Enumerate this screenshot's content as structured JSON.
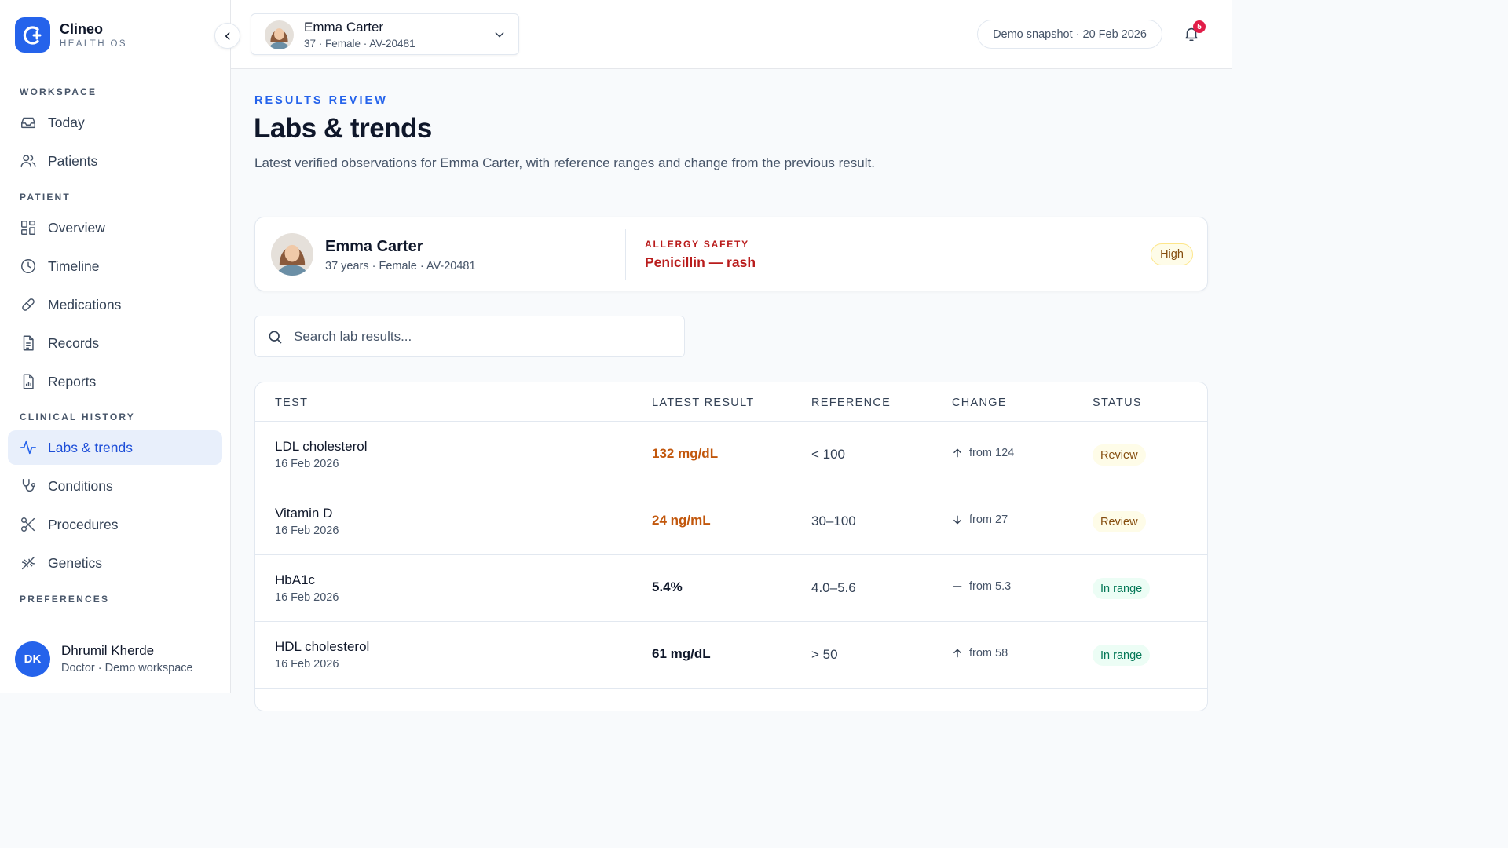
{
  "brand": {
    "name": "Clineo",
    "subtitle": "HEALTH OS"
  },
  "sidebar": {
    "sections": [
      "WORKSPACE",
      "PATIENT",
      "CLINICAL HISTORY",
      "PREFERENCES"
    ],
    "items": [
      {
        "label": "Today",
        "icon": "inbox-icon"
      },
      {
        "label": "Patients",
        "icon": "users-icon"
      },
      {
        "label": "Overview",
        "icon": "grid-icon"
      },
      {
        "label": "Timeline",
        "icon": "clock-icon"
      },
      {
        "label": "Medications",
        "icon": "pill-icon"
      },
      {
        "label": "Records",
        "icon": "file-icon"
      },
      {
        "label": "Reports",
        "icon": "report-icon"
      },
      {
        "label": "Labs & trends",
        "icon": "activity-icon",
        "active": true
      },
      {
        "label": "Conditions",
        "icon": "stethoscope-icon"
      },
      {
        "label": "Procedures",
        "icon": "scissors-icon"
      },
      {
        "label": "Genetics",
        "icon": "dna-icon"
      }
    ]
  },
  "user": {
    "initials": "DK",
    "name": "Dhrumil Kherde",
    "role": "Doctor · Demo workspace"
  },
  "topbar": {
    "patient_name": "Emma Carter",
    "patient_meta": "37 · Female · AV-20481",
    "snapshot": "Demo snapshot · 20 Feb 2026",
    "notifications": "5"
  },
  "page": {
    "eyebrow": "RESULTS REVIEW",
    "title": "Labs & trends",
    "description": "Latest verified observations for Emma Carter, with reference ranges and change from the previous result."
  },
  "patient_card": {
    "name": "Emma Carter",
    "meta": "37 years · Female · AV-20481",
    "allergy_label": "ALLERGY SAFETY",
    "allergy_value": "Penicillin — rash",
    "severity": "High"
  },
  "search": {
    "placeholder": "Search lab results..."
  },
  "table": {
    "headers": [
      "TEST",
      "LATEST RESULT",
      "REFERENCE",
      "CHANGE",
      "STATUS"
    ],
    "rows": [
      {
        "test": "LDL cholesterol",
        "date": "16 Feb 2026",
        "result": "132 mg/dL",
        "reference": "< 100",
        "change": "from 124",
        "direction": "up",
        "status": "Review"
      },
      {
        "test": "Vitamin D",
        "date": "16 Feb 2026",
        "result": "24 ng/mL",
        "reference": "30–100",
        "change": "from 27",
        "direction": "down",
        "status": "Review"
      },
      {
        "test": "HbA1c",
        "date": "16 Feb 2026",
        "result": "5.4%",
        "reference": "4.0–5.6",
        "change": "from 5.3",
        "direction": "flat",
        "status": "In range"
      },
      {
        "test": "HDL cholesterol",
        "date": "16 Feb 2026",
        "result": "61 mg/dL",
        "reference": "> 50",
        "change": "from 58",
        "direction": "up",
        "status": "In range"
      }
    ]
  },
  "colors": {
    "accent": "#2563eb",
    "warning": "#c2570c",
    "danger": "#b91c1c",
    "success": "#047857"
  }
}
